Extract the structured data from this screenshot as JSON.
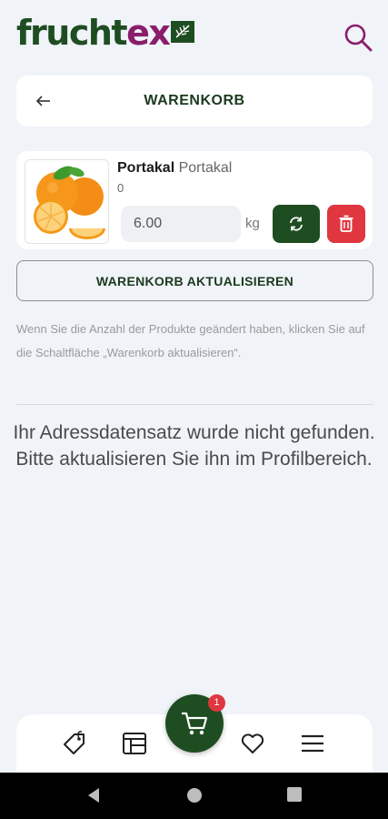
{
  "header": {
    "logo_part1": "frucht",
    "logo_part2": "ex",
    "search_icon": "search-icon"
  },
  "colors": {
    "brand_green": "#1f4d22",
    "brand_purple": "#8a1e6b",
    "danger_red": "#e03640",
    "background": "#f0f3f8"
  },
  "title_bar": {
    "back_icon": "arrow-left-icon",
    "title": "WARENKORB"
  },
  "cart_items": [
    {
      "name": "Portakal",
      "variant": "Portakal",
      "subtext": "0",
      "quantity": "6.00",
      "unit": "kg",
      "image_icon": "orange-fruit-image",
      "refresh_icon": "refresh-icon",
      "delete_icon": "trash-icon"
    }
  ],
  "update_button_label": "WARENKORB AKTUALISIEREN",
  "hint_text": "Wenn Sie die Anzahl der Produkte geändert haben, klicken Sie auf die Schaltfläche „Warenkorb aktualisieren“.",
  "address_message": "Ihr Adressdatensatz wurde nicht gefunden. Bitte aktualisieren Sie ihn im Profilbereich.",
  "bottom_nav": {
    "items": [
      "tag-icon",
      "layout-icon",
      "cart-icon",
      "heart-icon",
      "menu-icon"
    ],
    "cart_badge": "1"
  },
  "system_nav": [
    "back-triangle-icon",
    "home-circle-icon",
    "recents-square-icon"
  ]
}
